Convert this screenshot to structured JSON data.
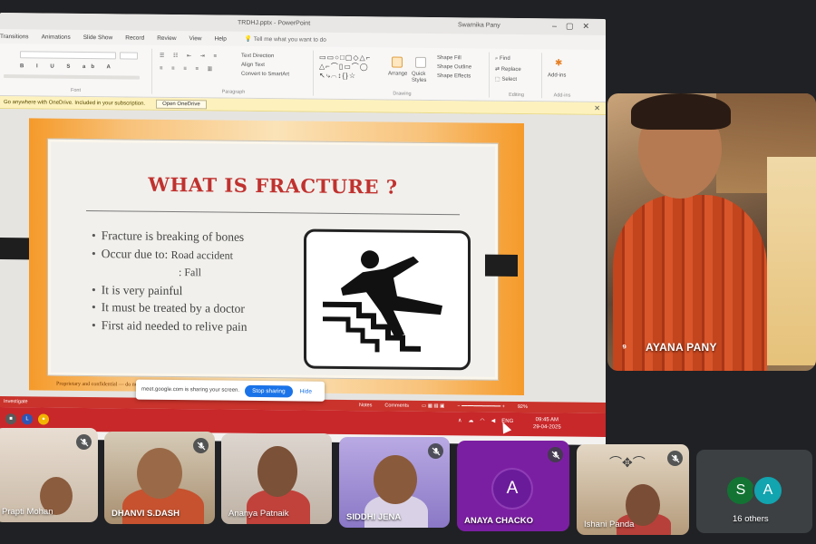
{
  "powerpoint": {
    "doc_title": "TRDHJ.pptx - PowerPoint",
    "user_name": "Swarnika Pany",
    "tabs": [
      "Transitions",
      "Animations",
      "Slide Show",
      "Record",
      "Review",
      "View",
      "Help"
    ],
    "tell_me": "Tell me what you want to do",
    "ribbon": {
      "group_font": "Font",
      "group_paragraph": "Paragraph",
      "group_drawing": "Drawing",
      "group_editing": "Editing",
      "group_addins": "Add-ins",
      "cmd_text_direction": "Text Direction",
      "cmd_align_text": "Align Text",
      "cmd_convert_smartart": "Convert to SmartArt",
      "cmd_arrange": "Arrange",
      "cmd_quick_styles": "Quick Styles",
      "cmd_shape_fill": "Shape Fill",
      "cmd_shape_outline": "Shape Outline",
      "cmd_shape_effects": "Shape Effects",
      "cmd_find": "Find",
      "cmd_replace": "Replace",
      "cmd_select": "Select",
      "cmd_addins": "Add-ins"
    },
    "infobar": {
      "text": "Go anywhere with OneDrive. Included in your subscription.",
      "button": "Open OneDrive"
    },
    "slide": {
      "title": "WHAT IS FRACTURE ?",
      "bullets": [
        "Fracture is breaking of bones",
        "Occur due to:",
        "It is very painful",
        "It must be treated by a doctor",
        "First aid needed to relive pain"
      ],
      "cause_1": "Road accident",
      "cause_2": ": Fall",
      "footer": "Proprietary and confidential — do not distribute"
    },
    "status_bar": {
      "left": "Investigate",
      "notes": "Notes",
      "comments": "Comments",
      "zoom": "92%"
    },
    "taskbar": {
      "language": "ENG",
      "time": "09:45 AM",
      "date": "29-04-2025"
    }
  },
  "share_banner": {
    "text": "meet.google.com is sharing your screen.",
    "stop_label": "Stop sharing",
    "hide_label": "Hide"
  },
  "participants": {
    "featured": {
      "name": "AYANA PANY"
    },
    "tiles": [
      {
        "name": "Prapti Mohan"
      },
      {
        "name": "DHANVI S.DASH"
      },
      {
        "name": "Ananya Patnaik"
      },
      {
        "name": "SIDDHI JENA"
      },
      {
        "name": "ANAYA CHACKO",
        "initial": "A"
      },
      {
        "name": "Ishani Panda"
      }
    ],
    "others": {
      "label": "16 others",
      "initials": [
        "S",
        "A"
      ]
    }
  },
  "colors": {
    "meet_bg": "#202124",
    "slide_title": "#c0322f",
    "stop_sharing": "#1a73e8",
    "anaya_tile": "#7b1fa2",
    "avatar_s": "#137333",
    "avatar_a": "#12a4af"
  }
}
